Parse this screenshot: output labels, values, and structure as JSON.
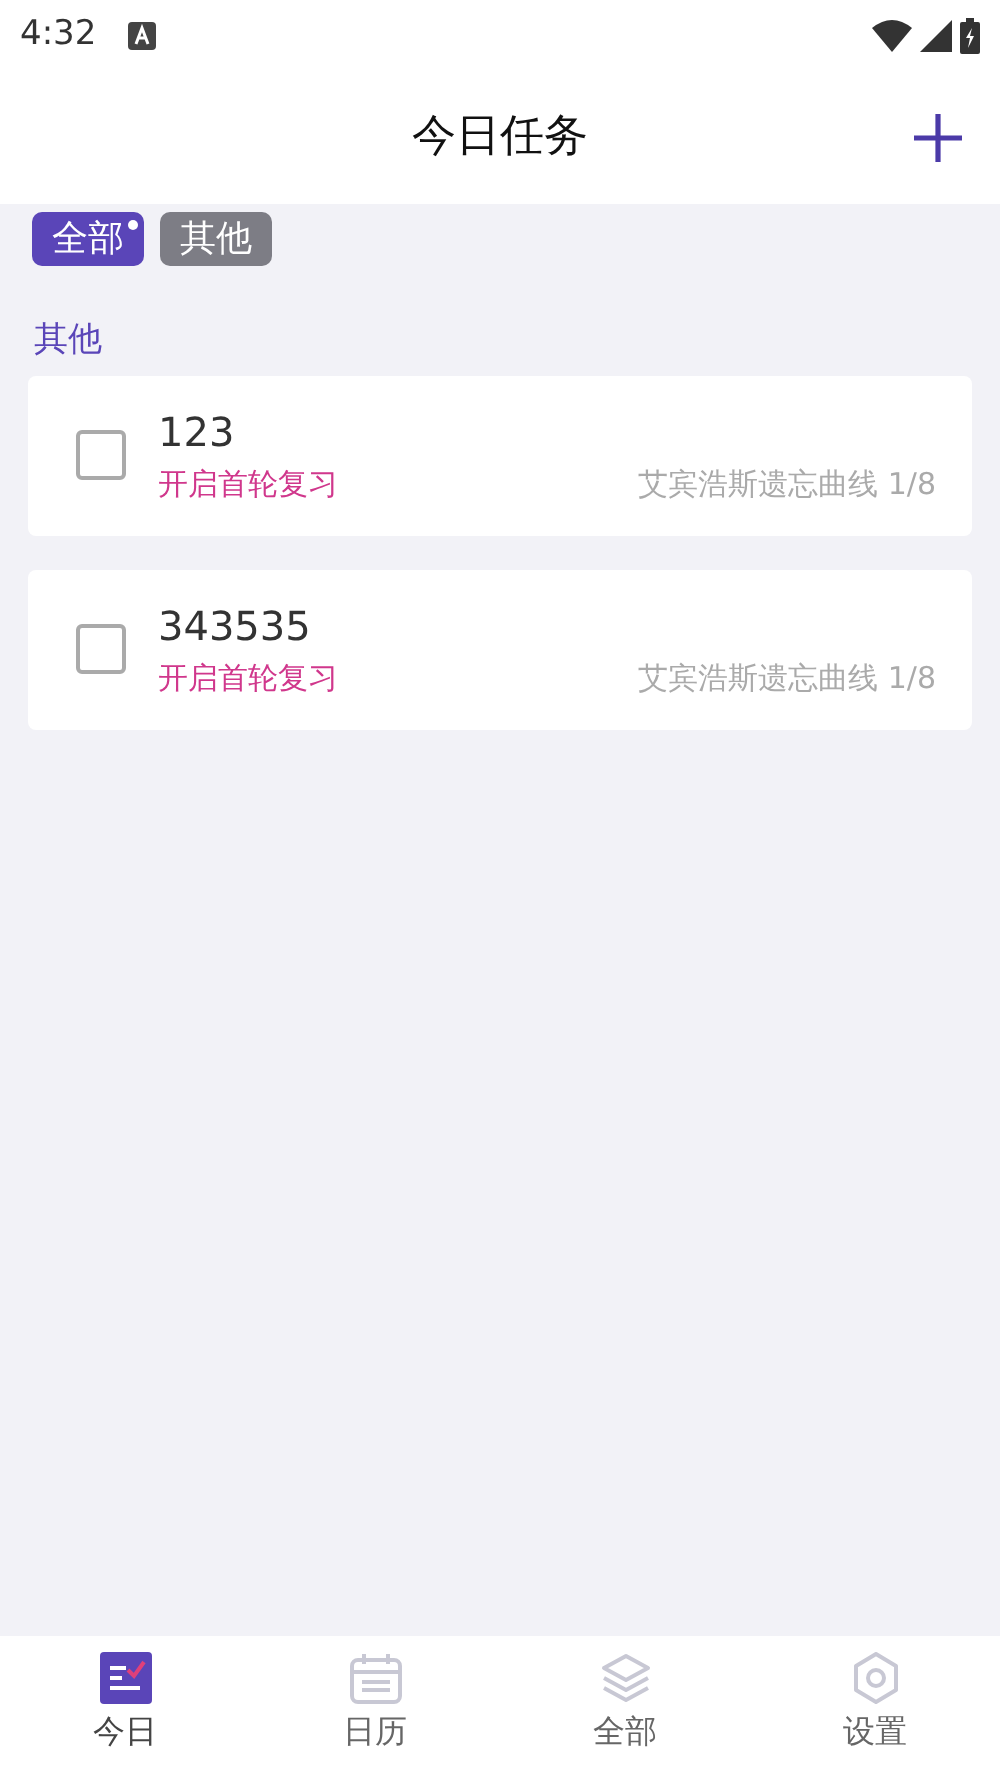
{
  "status_bar": {
    "time": "4:32"
  },
  "header": {
    "title": "今日任务"
  },
  "filters": [
    {
      "label": "全部",
      "selected": true
    },
    {
      "label": "其他",
      "selected": false
    }
  ],
  "section": {
    "title": "其他"
  },
  "tasks": [
    {
      "name": "123",
      "checked": false,
      "action": "开启首轮复习",
      "schedule": "艾宾浩斯遗忘曲线 1/8"
    },
    {
      "name": "343535",
      "checked": false,
      "action": "开启首轮复习",
      "schedule": "艾宾浩斯遗忘曲线 1/8"
    }
  ],
  "bottom_nav": [
    {
      "kind": "today",
      "label": "今日",
      "selected": true
    },
    {
      "kind": "calendar",
      "label": "日历",
      "selected": false
    },
    {
      "kind": "all",
      "label": "全部",
      "selected": false
    },
    {
      "kind": "settings",
      "label": "设置",
      "selected": false
    }
  ]
}
